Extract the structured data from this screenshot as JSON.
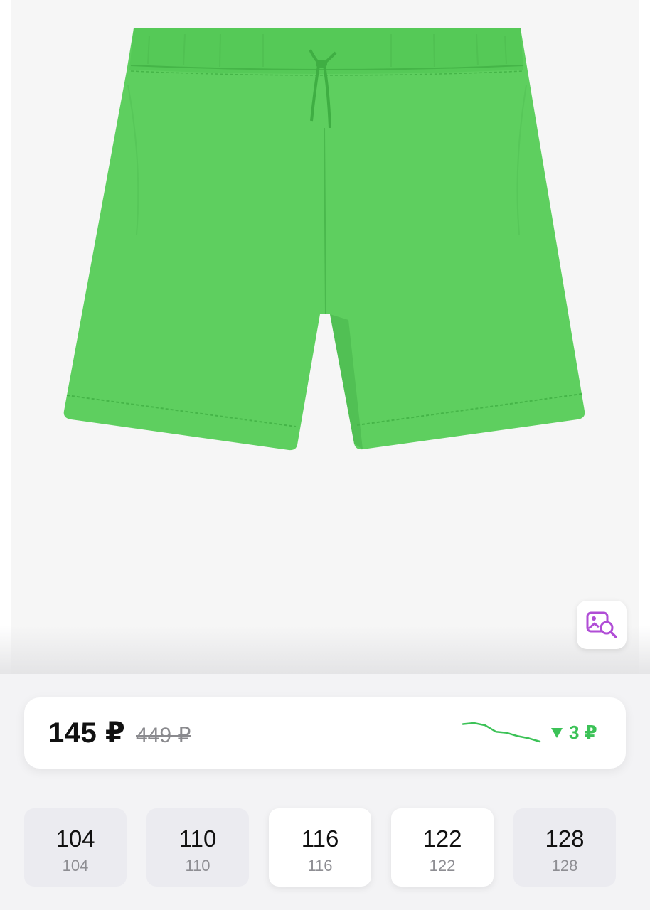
{
  "product": {
    "image_subject": "green shorts",
    "colors": {
      "fabric": "#5ecf5f",
      "fabric_shade": "#49b64c",
      "accent_icon": "#b04dd6"
    }
  },
  "price": {
    "current": "145 ₽",
    "old": "449 ₽",
    "change": "3 ₽",
    "change_direction": "down",
    "trend_points": [
      7,
      6,
      8,
      14,
      15,
      18,
      20,
      23
    ]
  },
  "sizes": [
    {
      "label": "104",
      "sub": "104",
      "selected": false
    },
    {
      "label": "110",
      "sub": "110",
      "selected": false
    },
    {
      "label": "116",
      "sub": "116",
      "selected": true
    },
    {
      "label": "122",
      "sub": "122",
      "selected": true
    },
    {
      "label": "128",
      "sub": "128",
      "selected": false
    }
  ],
  "icons": {
    "visual_search": "image-search-icon",
    "change_arrow": "triangle-down-icon"
  }
}
